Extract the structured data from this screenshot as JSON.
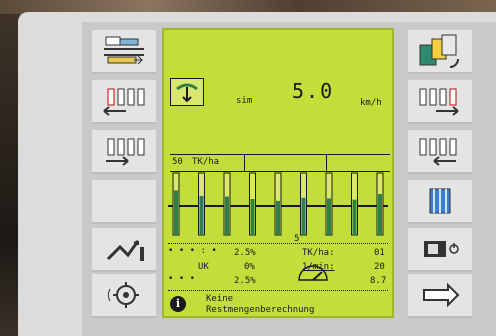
{
  "speed": {
    "value": "5.0",
    "unit": "km/h",
    "source": "sim"
  },
  "bar_section": {
    "target_value": "50",
    "unit_label": "TK/ha"
  },
  "stats": {
    "row1_pct": "2.5%",
    "row1_label": "TK/ha:",
    "row1_value": "01",
    "uk_label": "UK",
    "row2_pct": "0%",
    "row2_label": "1/min:",
    "row2_value": "20",
    "row3_pct": "2.5%",
    "row3_value": "8.7",
    "center_digit": "5"
  },
  "info": {
    "line1": "Keine",
    "line2": "Restmengenberechnung"
  },
  "icons": {
    "left": [
      "section-control-icon",
      "shutoff-left-outer-icon",
      "shutoff-left-inner-icon",
      "empty-softkey",
      "hydraulic-fold-icon",
      "wheel-rate-icon"
    ],
    "right": [
      "copy-settings-icon",
      "shutoff-right-outer-icon",
      "shutoff-right-inner-icon",
      "all-sections-icon",
      "terminal-power-icon",
      "next-page-icon"
    ],
    "accent_color": "#c3dd3a"
  },
  "row_levels": [
    0.72,
    0.63,
    0.62,
    0.58,
    0.55,
    0.6,
    0.59,
    0.57,
    0.66
  ]
}
